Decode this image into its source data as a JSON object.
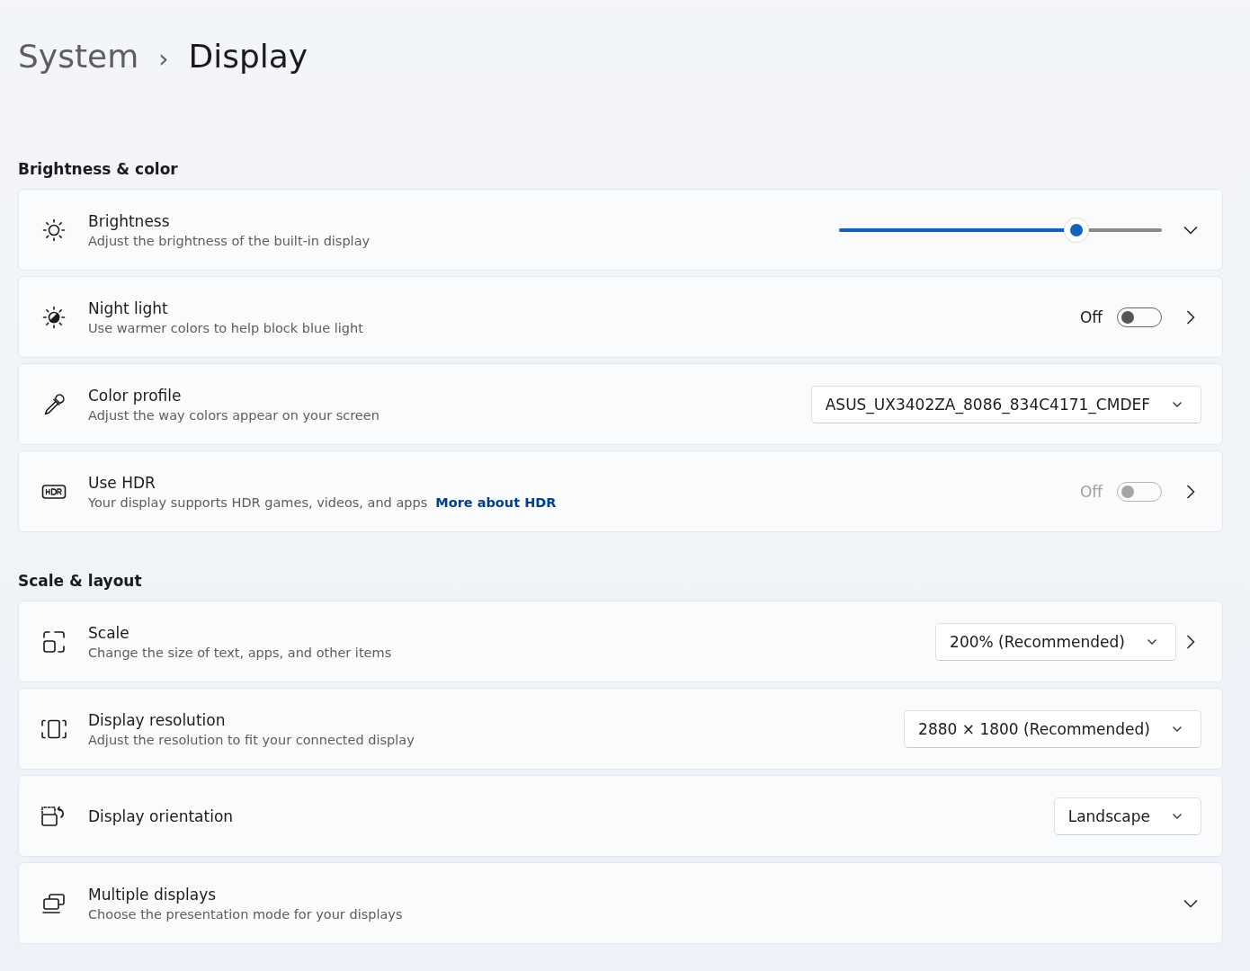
{
  "breadcrumb": {
    "parent": "System",
    "separator": "›",
    "current": "Display"
  },
  "sections": [
    {
      "heading": "Brightness & color",
      "rows": [
        {
          "kind": "slider",
          "title": "Brightness",
          "description": "Adjust the brightness of the built-in display",
          "level": 0.735,
          "expandable": true
        },
        {
          "kind": "toggle",
          "title": "Night light",
          "description": "Use warmer colors to help block blue light",
          "state_label": "Off",
          "on": false,
          "disabled": false,
          "opens_page": true
        },
        {
          "kind": "dropdown",
          "title": "Color profile",
          "description": "Adjust the way colors appear on your screen",
          "value": "ASUS_UX3402ZA_8086_834C4171_CMDEF"
        },
        {
          "kind": "toggle",
          "title": "Use HDR",
          "description": "Your display supports HDR games, videos, and apps",
          "link": "More about HDR",
          "state_label": "Off",
          "on": false,
          "disabled": true,
          "opens_page": true
        }
      ]
    },
    {
      "heading": "Scale & layout",
      "rows": [
        {
          "kind": "dropdown",
          "title": "Scale",
          "description": "Change the size of text, apps, and other items",
          "value": "200% (Recommended)",
          "opens_page": true
        },
        {
          "kind": "dropdown",
          "title": "Display resolution",
          "description": "Adjust the resolution to fit your connected display",
          "value": "2880 × 1800 (Recommended)"
        },
        {
          "kind": "dropdown",
          "title": "Display orientation",
          "value": "Landscape"
        },
        {
          "kind": "plain",
          "title": "Multiple displays",
          "description": "Choose the presentation mode for your displays",
          "expandable": true
        }
      ]
    }
  ]
}
